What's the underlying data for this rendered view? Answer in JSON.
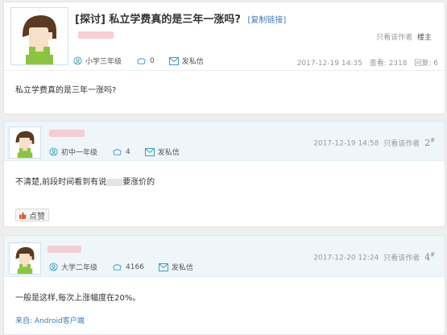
{
  "post": {
    "title_tag": "[探讨]",
    "title": "私立学费真的是三年一涨吗?",
    "copy_link": "[复制链接]",
    "only_author": "只看该作者",
    "floor_label": "楼主",
    "grade": "小学三年级",
    "count": "0",
    "message": "发私信",
    "timestamp": "2017-12-19 14:35",
    "views": "查看: 2318",
    "replies": "回复: 6",
    "body": "私立学费真的是三年一涨吗?"
  },
  "replies": [
    {
      "grade": "初中一年级",
      "count": "4",
      "message": "发私信",
      "timestamp": "2017-12-19 14:58",
      "only_author": "只看该作者",
      "floor": "2",
      "floor_suffix": "#",
      "body_prefix": "不清楚,前段时间看到有说",
      "body_suffix": "要涨价的",
      "like_label": "点赞"
    },
    {
      "grade": "大学二年级",
      "count": "4166",
      "message": "发私信",
      "timestamp": "2017-12-20 12:24",
      "only_author": "只看该作者",
      "floor": "4",
      "floor_suffix": "#",
      "body": "一般是这样,每次上涨幅度在20%。",
      "source": "来自: Android客户端"
    }
  ],
  "colors": {
    "header_bg": "#eef6f9",
    "link_blue": "#3b7bbf",
    "blur_pink": "#f6c6cf",
    "avatar_hair": "#5a3a22",
    "avatar_skin": "#f7e0c8",
    "avatar_shirt": "#8bc53f"
  },
  "icons": [
    "user-icon",
    "flower-icon",
    "mail-icon",
    "thumbs-up-icon"
  ]
}
